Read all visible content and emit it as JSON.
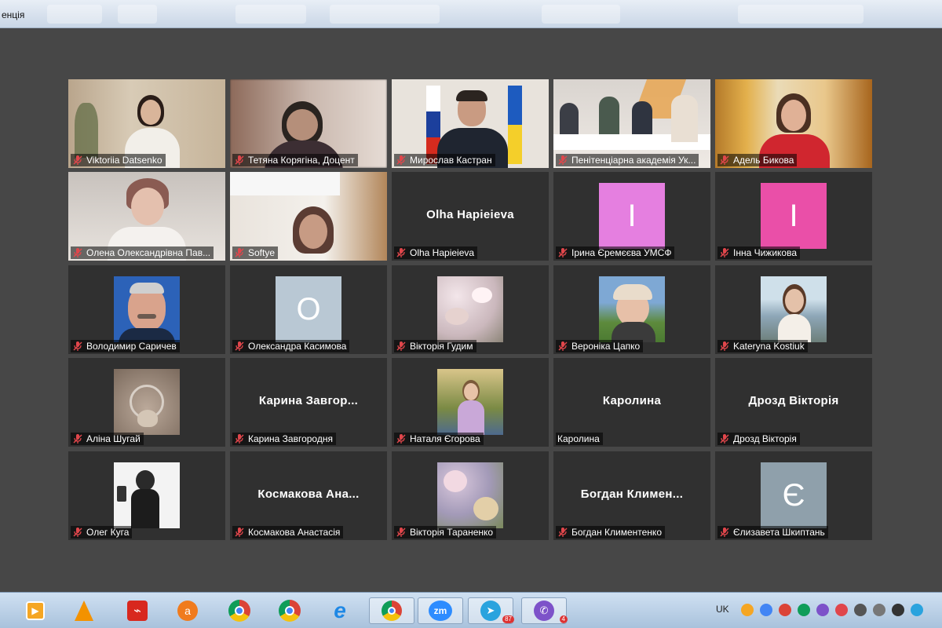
{
  "window": {
    "title": "енція"
  },
  "participants": [
    {
      "name": "Viktoriia Datsenko",
      "kind": "video",
      "scene": "room-dark-hair"
    },
    {
      "name": "Тетяна Корягіна, Доцент",
      "kind": "video",
      "scene": "blurred-woman"
    },
    {
      "name": "Мирослав Кастран",
      "kind": "video",
      "scene": "man-flags",
      "active": true
    },
    {
      "name": "Пенітенціарна академія Ук...",
      "kind": "video",
      "scene": "meeting-room"
    },
    {
      "name": "Адель Бикова",
      "kind": "video",
      "scene": "woman-red-curtains"
    },
    {
      "name": "Олена Олександрівна Пав...",
      "kind": "video",
      "scene": "older-woman"
    },
    {
      "name": "Softye",
      "kind": "video",
      "scene": "woman-window"
    },
    {
      "name": "Olha Hapieieva",
      "kind": "text",
      "display": "Olha Hapieieva"
    },
    {
      "name": "Ірина Єремєєва УМСФ",
      "kind": "letter",
      "letter": "І",
      "color": "#e57fe0"
    },
    {
      "name": "Інна Чижикова",
      "kind": "letter",
      "letter": "І",
      "color": "#ea4fa8"
    },
    {
      "name": "Володимир Саричев",
      "kind": "photo",
      "scene": "man-blue"
    },
    {
      "name": "Олександра Касимова",
      "kind": "letter",
      "letter": "О",
      "color": "#b9c8d4"
    },
    {
      "name": "Вікторія Гудим",
      "kind": "photo",
      "scene": "blossom"
    },
    {
      "name": "Вероніка Цапко",
      "kind": "photo",
      "scene": "girl-cap"
    },
    {
      "name": "Kateryna Kostiuk",
      "kind": "photo",
      "scene": "girl-river"
    },
    {
      "name": "Аліна Шугай",
      "kind": "photo",
      "scene": "necklace"
    },
    {
      "name": "Карина Завгородня",
      "kind": "text",
      "display": "Карина  Завгор..."
    },
    {
      "name": "Наталя Єгорова",
      "kind": "photo",
      "scene": "girl-park"
    },
    {
      "name": "Каролина",
      "kind": "text",
      "display": "Каролина",
      "nomic": true
    },
    {
      "name": "Дрозд Вікторія",
      "kind": "text",
      "display": "Дрозд Вікторія"
    },
    {
      "name": "Олег Куга",
      "kind": "photo",
      "scene": "mirror-selfie"
    },
    {
      "name": "Космакова Анастасія",
      "kind": "text",
      "display": "Космакова  Ана..."
    },
    {
      "name": "Вікторія Тараненко",
      "kind": "photo",
      "scene": "flowers"
    },
    {
      "name": "Богдан Климентенко",
      "kind": "text",
      "display": "Богдан  Климен..."
    },
    {
      "name": "Єлизавета Шкиптань",
      "kind": "letter",
      "letter": "Є",
      "color": "#8fa0ab"
    }
  ],
  "taskbar": {
    "apps": [
      {
        "icon": "media-player-icon"
      },
      {
        "icon": "vlc-icon"
      },
      {
        "icon": "pdf-reader-icon"
      },
      {
        "icon": "avast-icon"
      },
      {
        "icon": "chrome-icon"
      },
      {
        "icon": "chrome-beta-icon"
      },
      {
        "icon": "internet-explorer-icon"
      },
      {
        "icon": "chrome-profile-icon",
        "boxed": true
      },
      {
        "icon": "zoom-icon",
        "label": "zm",
        "boxed": true
      },
      {
        "icon": "telegram-icon",
        "badge": "87",
        "boxed": true
      },
      {
        "icon": "viber-icon",
        "badge": "4",
        "boxed": true
      }
    ],
    "language": "UK"
  },
  "colors": {
    "active_border": "#dcd067",
    "tile_bg": "#303030",
    "stage_bg": "#474747",
    "mic_muted": "#e0464b"
  }
}
